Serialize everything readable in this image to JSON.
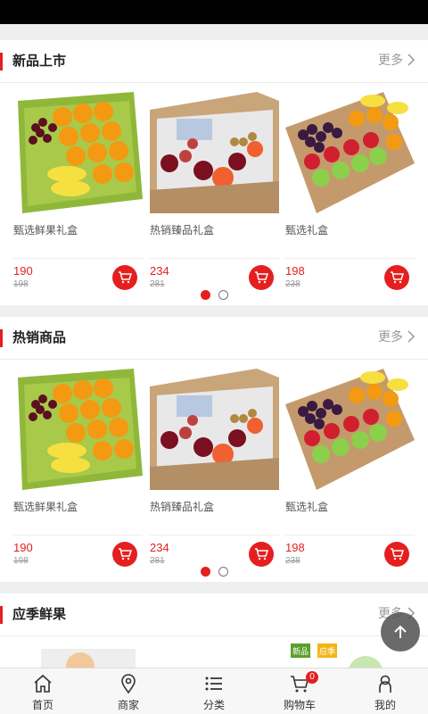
{
  "sections": [
    {
      "title": "新品上市",
      "more": "更多",
      "products": [
        {
          "name": "甄选鲜果礼盒",
          "price": "190",
          "orig": "198",
          "image": "fruit-box-oranges"
        },
        {
          "name": "热销臻品礼盒",
          "price": "234",
          "orig": "281",
          "image": "fruit-box-mixed"
        },
        {
          "name": "甄选礼盒",
          "price": "198",
          "orig": "238",
          "image": "fruit-box-grapes"
        }
      ]
    },
    {
      "title": "热销商品",
      "more": "更多",
      "products": [
        {
          "name": "甄选鲜果礼盒",
          "price": "190",
          "orig": "198",
          "image": "fruit-box-oranges"
        },
        {
          "name": "热销臻品礼盒",
          "price": "234",
          "orig": "281",
          "image": "fruit-box-mixed"
        },
        {
          "name": "甄选礼盒",
          "price": "198",
          "orig": "238",
          "image": "fruit-box-grapes"
        }
      ]
    },
    {
      "title": "应季鲜果",
      "more": "更多",
      "tags": [
        "新品",
        "应季"
      ]
    }
  ],
  "carousel": {
    "pages": 2,
    "active": 0
  },
  "tabbar": [
    {
      "label": "首页",
      "icon": "home-icon"
    },
    {
      "label": "商家",
      "icon": "location-pin-icon"
    },
    {
      "label": "分类",
      "icon": "list-icon"
    },
    {
      "label": "购物车",
      "icon": "cart-icon",
      "badge": "0"
    },
    {
      "label": "我的",
      "icon": "user-icon"
    }
  ],
  "colors": {
    "accent": "#e51f1f",
    "background": "#efefef"
  }
}
